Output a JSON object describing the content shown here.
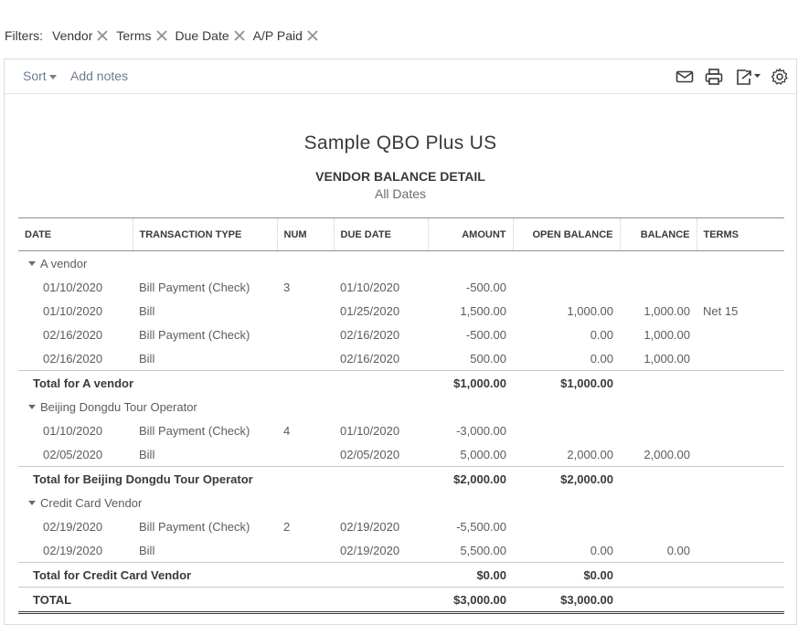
{
  "filters": {
    "label": "Filters:",
    "chips": [
      "Vendor",
      "Terms",
      "Due Date",
      "A/P Paid"
    ]
  },
  "toolbar": {
    "sort_label": "Sort",
    "add_notes_label": "Add notes",
    "icons": [
      "mail-icon",
      "print-icon",
      "export-icon",
      "settings-icon"
    ]
  },
  "report": {
    "company": "Sample QBO Plus US",
    "title": "VENDOR BALANCE DETAIL",
    "subtitle": "All Dates",
    "columns": [
      "DATE",
      "TRANSACTION TYPE",
      "NUM",
      "DUE DATE",
      "AMOUNT",
      "OPEN BALANCE",
      "BALANCE",
      "TERMS"
    ],
    "groups": [
      {
        "name": "A vendor",
        "rows": [
          [
            "01/10/2020",
            "Bill Payment (Check)",
            "3",
            "01/10/2020",
            "-500.00",
            "",
            "",
            ""
          ],
          [
            "01/10/2020",
            "Bill",
            "",
            "01/25/2020",
            "1,500.00",
            "1,000.00",
            "1,000.00",
            "Net 15"
          ],
          [
            "02/16/2020",
            "Bill Payment (Check)",
            "",
            "02/16/2020",
            "-500.00",
            "0.00",
            "1,000.00",
            ""
          ],
          [
            "02/16/2020",
            "Bill",
            "",
            "02/16/2020",
            "500.00",
            "0.00",
            "1,000.00",
            ""
          ]
        ],
        "total_label": "Total for A vendor",
        "total_amount": "$1,000.00",
        "total_open": "$1,000.00"
      },
      {
        "name": "Beijing Dongdu Tour Operator",
        "rows": [
          [
            "01/10/2020",
            "Bill Payment (Check)",
            "4",
            "01/10/2020",
            "-3,000.00",
            "",
            "",
            ""
          ],
          [
            "02/05/2020",
            "Bill",
            "",
            "02/05/2020",
            "5,000.00",
            "2,000.00",
            "2,000.00",
            ""
          ]
        ],
        "total_label": "Total for Beijing Dongdu Tour Operator",
        "total_amount": "$2,000.00",
        "total_open": "$2,000.00"
      },
      {
        "name": "Credit Card Vendor",
        "rows": [
          [
            "02/19/2020",
            "Bill Payment (Check)",
            "2",
            "02/19/2020",
            "-5,500.00",
            "",
            "",
            ""
          ],
          [
            "02/19/2020",
            "Bill",
            "",
            "02/19/2020",
            "5,500.00",
            "0.00",
            "0.00",
            ""
          ]
        ],
        "total_label": "Total for Credit Card Vendor",
        "total_amount": "$0.00",
        "total_open": "$0.00"
      }
    ],
    "grand_total": {
      "label": "TOTAL",
      "amount": "$3,000.00",
      "open": "$3,000.00"
    }
  },
  "colors": {
    "link": "#6b7c93",
    "text": "#393a3d",
    "muted": "#5b5c60"
  }
}
